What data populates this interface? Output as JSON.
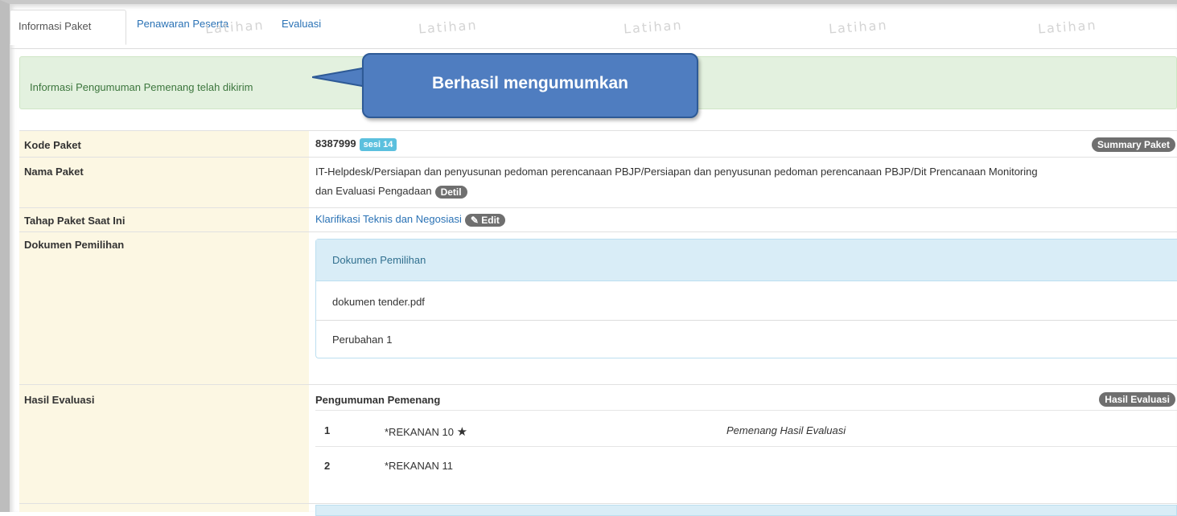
{
  "tabs": [
    {
      "label": "Informasi Paket",
      "active": true
    },
    {
      "label": "Penawaran Peserta",
      "active": false
    },
    {
      "label": "Evaluasi",
      "active": false
    }
  ],
  "watermark": "Latihan",
  "alert": {
    "message": "Informasi Pengumuman Pemenang telah dikirim",
    "callout": "Berhasil mengumumkan"
  },
  "rows": {
    "kode": {
      "label": "Kode Paket",
      "value": "8387999",
      "badge": "sesi 14",
      "button": "Summary Paket"
    },
    "nama": {
      "label": "Nama Paket",
      "line1": "IT-Helpdesk/Persiapan dan penyusunan pedoman perencanaan PBJP/Persiapan dan penyusunan pedoman perencanaan PBJP/Dit Prencanaan Monitoring",
      "line2": "dan Evaluasi Pengadaan",
      "button": "Detil"
    },
    "tahap": {
      "label": "Tahap Paket Saat Ini",
      "value": "Klarifikasi Teknis dan Negosiasi",
      "button": "Edit"
    },
    "dokumen": {
      "label": "Dokumen Pemilihan",
      "panel_title": "Dokumen Pemilihan",
      "items": [
        "dokumen tender.pdf",
        "Perubahan 1"
      ]
    },
    "hasil": {
      "label": "Hasil Evaluasi",
      "sub_title": "Pengumuman Pemenang",
      "button": "Hasil Evaluasi",
      "results": [
        {
          "no": "1",
          "name": "*REKANAN 10",
          "starred": true,
          "note": "Pemenang Hasil Evaluasi"
        },
        {
          "no": "2",
          "name": "*REKANAN 11",
          "starred": false,
          "note": ""
        }
      ]
    }
  },
  "colors": {
    "callout": "#4f7dc0",
    "alert_bg": "#e3f1df",
    "label_bg": "#fcf7e3",
    "link": "#2a72b5",
    "badge": "#5bc0de"
  }
}
